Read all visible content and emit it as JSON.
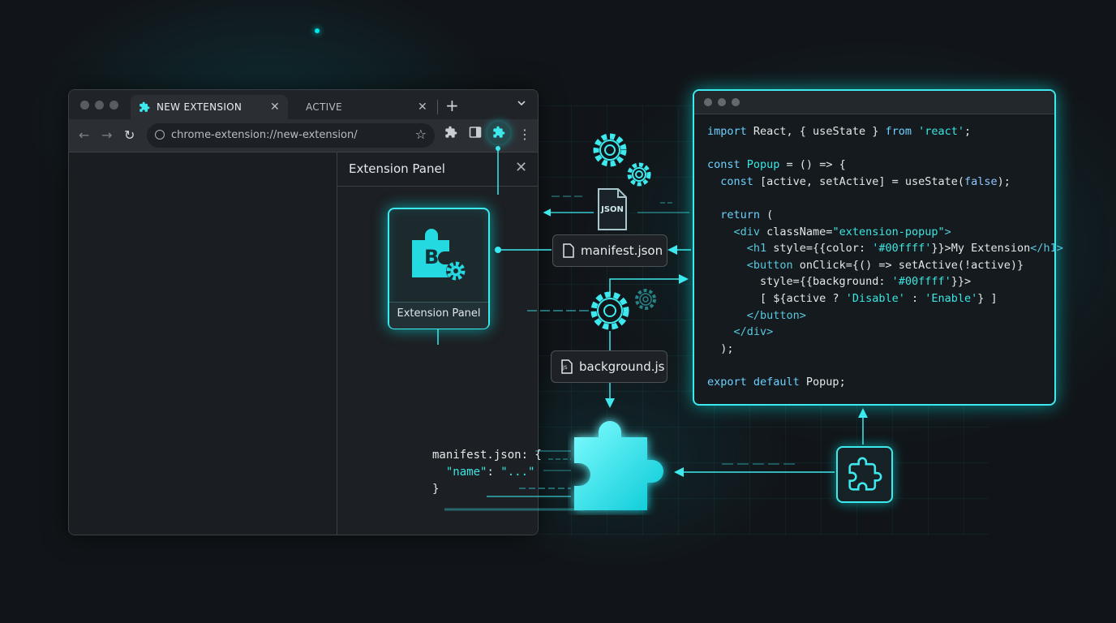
{
  "browser": {
    "tabs": [
      {
        "label": "NEW EXTENSION",
        "icon": "puzzle-icon",
        "active": true
      },
      {
        "label": "ACTIVE",
        "active": false
      }
    ],
    "new_tab_symbol": "+",
    "tab_menu_symbol": "⌄",
    "close_symbol": "✕",
    "address": "chrome-extension://new-extension/",
    "nav": {
      "back": "←",
      "forward": "→",
      "reload": "↻"
    },
    "star_symbol": "☆",
    "menu_symbol": "⋮"
  },
  "panel": {
    "title": "Extension Panel",
    "close_symbol": "✕",
    "card_label": "Extension Panel",
    "card_letter": "B"
  },
  "files": {
    "json_badge": "JSON",
    "manifest_chip": "manifest.json",
    "background_chip": "background.js",
    "js_badge": "JS"
  },
  "snippet": {
    "line1": "manifest.json: {",
    "line2_key": "\"name\"",
    "line2_sep": ": ",
    "line2_val": "\"...\"",
    "line3": "}"
  },
  "code": {
    "l1_import": "import",
    "l1_mid": " React, { useState } ",
    "l1_from": "from",
    "l1_str": " 'react'",
    "l1_end": ";",
    "l3_const": "const",
    "l3_name": " Popup",
    "l3_rest": " = () => {",
    "l4_indent": "  ",
    "l4_const": "const",
    "l4_mid": " [active, setActive] = useState(",
    "l4_false": "false",
    "l4_end": ");",
    "l6_return": "  return",
    "l6_end": " (",
    "l7_open": "    <div ",
    "l7_attr": "className=",
    "l7_str": "\"extension-popup\"",
    "l7_close": ">",
    "l8_open": "      <h1 ",
    "l8_attr": "style={{color: ",
    "l8_str": "'#00ffff'",
    "l8_mid": "}}>",
    "l8_text": "My Extension",
    "l8_close": "</h1>",
    "l9_open": "      <button ",
    "l9_attr": "onClick={() => setActive(!active)}",
    "l10_attr": "        style={{background: ",
    "l10_str": "'#00ffff'",
    "l10_end": "}}>",
    "l11_pre": "        [ ${active ? ",
    "l11_s1": "'Disable'",
    "l11_mid": " : ",
    "l11_s2": "'Enable'",
    "l11_end": "} ]",
    "l12": "      </button>",
    "l13": "    </div>",
    "l14": "  );",
    "l16_export": "export default",
    "l16_rest": " Popup;"
  },
  "colors": {
    "accent": "#00ffff",
    "accent_border": "#3ee9ee",
    "background": "#111519"
  }
}
